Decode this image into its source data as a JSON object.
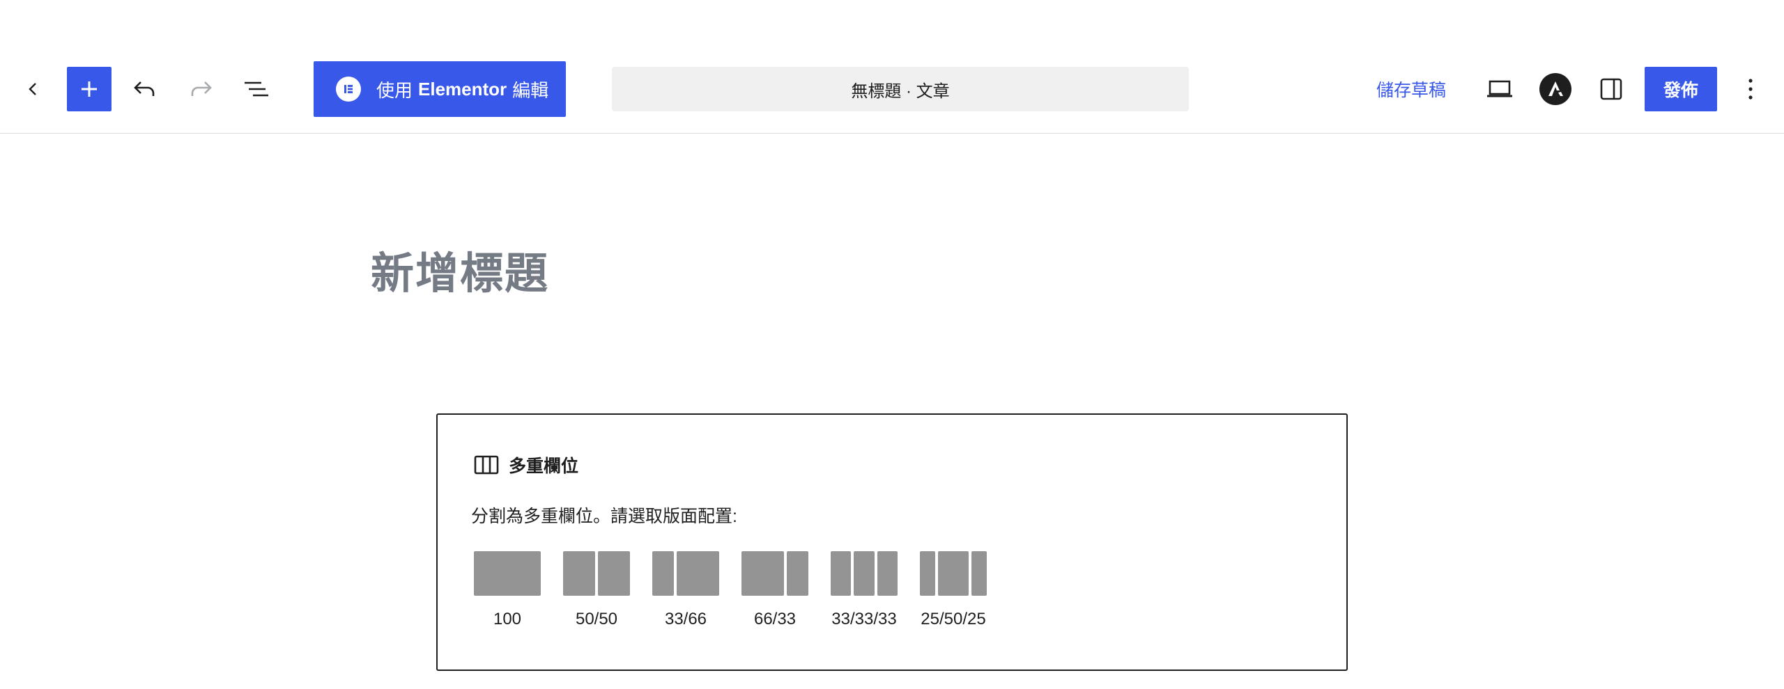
{
  "toolbar": {
    "back_icon": "chevron-left-icon",
    "add_icon": "plus-icon",
    "undo_icon": "undo-icon",
    "redo_icon": "redo-icon",
    "outline_icon": "list-view-icon",
    "elementor": {
      "label_pre": "使用",
      "label_strong": "Elementor",
      "label_post": "編輯",
      "icon": "elementor-logo-icon"
    },
    "document_title": "無標題 · 文章",
    "save_draft": "儲存草稿",
    "preview_icon": "laptop-icon",
    "astra_icon": "astra-logo-icon",
    "settings_icon": "sidebar-toggle-icon",
    "publish": "發佈",
    "more_icon": "more-vertical-icon",
    "accent_color": "#3858e9"
  },
  "editor": {
    "post_title_placeholder": "新增標題",
    "columns_block": {
      "icon": "columns-icon",
      "title": "多重欄位",
      "instructions": "分割為多重欄位。請選取版面配置:",
      "variations": [
        {
          "label": "100",
          "parts": [
            100
          ]
        },
        {
          "label": "50/50",
          "parts": [
            50,
            50
          ]
        },
        {
          "label": "33/66",
          "parts": [
            33,
            66
          ]
        },
        {
          "label": "66/33",
          "parts": [
            66,
            33
          ]
        },
        {
          "label": "33/33/33",
          "parts": [
            33,
            33,
            33
          ]
        },
        {
          "label": "25/50/25",
          "parts": [
            25,
            50,
            25
          ]
        }
      ]
    }
  }
}
